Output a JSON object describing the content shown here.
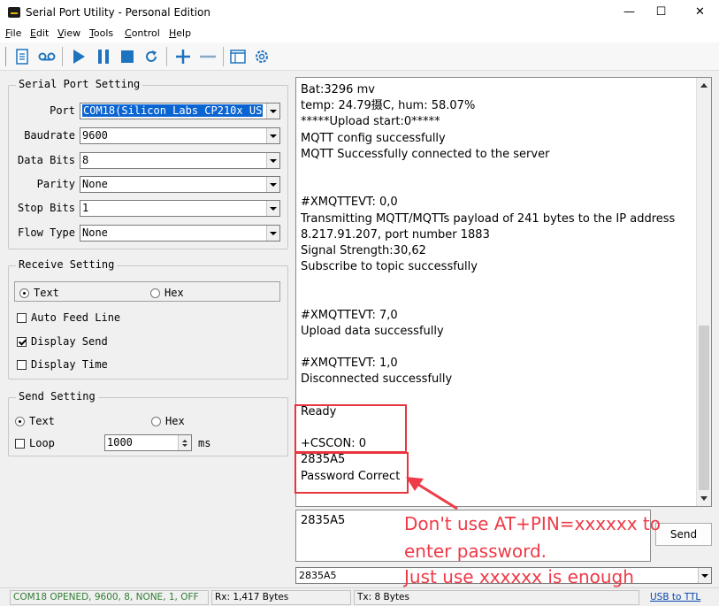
{
  "window": {
    "title": "Serial Port Utility - Personal Edition",
    "minimize": "—",
    "maximize": "☐",
    "close": "✕"
  },
  "menu": {
    "items": [
      {
        "key": "F",
        "rest": "ile"
      },
      {
        "key": "E",
        "rest": "dit"
      },
      {
        "key": "V",
        "rest": "iew"
      },
      {
        "key": "T",
        "rest": "ools"
      },
      {
        "key": "C",
        "rest": "ontrol"
      },
      {
        "key": "H",
        "rest": "elp"
      }
    ]
  },
  "toolbar": {
    "icons": [
      "document-icon",
      "tape-icon",
      "play-icon",
      "pause-icon",
      "stop-icon",
      "refresh-icon",
      "add-icon",
      "remove-icon",
      "window-icon",
      "settings-icon"
    ],
    "accent": "#1e73be"
  },
  "serial_port_setting": {
    "title": "Serial Port Setting",
    "fields": [
      {
        "label": "Port",
        "value": "COM18(Silicon Labs CP210x US"
      },
      {
        "label": "Baudrate",
        "value": "9600"
      },
      {
        "label": "Data Bits",
        "value": "8"
      },
      {
        "label": "Parity",
        "value": "None"
      },
      {
        "label": "Stop Bits",
        "value": "1"
      },
      {
        "label": "Flow Type",
        "value": "None"
      }
    ]
  },
  "receive_setting": {
    "title": "Receive Setting",
    "text_label": "Text",
    "hex_label": "Hex",
    "mode": "Text",
    "auto_feed_line": {
      "label": "Auto Feed Line",
      "checked": false
    },
    "display_send": {
      "label": "Display Send",
      "checked": true
    },
    "display_time": {
      "label": "Display Time",
      "checked": false
    }
  },
  "send_setting": {
    "title": "Send Setting",
    "text_label": "Text",
    "hex_label": "Hex",
    "mode": "Text",
    "loop": {
      "label": "Loop",
      "checked": false
    },
    "interval_value": "1000",
    "interval_unit": "ms"
  },
  "receive_log": {
    "lines": [
      "Bat:3296 mv",
      "temp: 24.79摄C, hum: 58.07%",
      "*****Upload start:0*****",
      "MQTT config successfully",
      "MQTT Successfully connected to the server",
      "",
      "",
      "#XMQTTEVT: 0,0",
      "Transmitting MQTT/MQTTs payload of 241 bytes to the IP address",
      "8.217.91.207, port number 1883",
      "Signal Strength:30,62",
      "Subscribe to topic successfully",
      "",
      "",
      "#XMQTTEVT: 7,0",
      "Upload data successfully",
      "",
      "#XMQTTEVT: 1,0",
      "Disconnected successfully",
      "",
      "Ready",
      "",
      "+CSCON: 0",
      "2835A5",
      "Password Correct"
    ]
  },
  "send_box": {
    "text": "2835A5",
    "send_label": "Send"
  },
  "history": {
    "value": "2835A5"
  },
  "annotation": {
    "lines": [
      "Don't use AT+PIN=xxxxxx to",
      "enter password.",
      "Just use xxxxxx is enough"
    ],
    "color": "#ee3b47"
  },
  "status": {
    "port_status": "COM18 OPENED, 9600, 8, NONE, 1, OFF",
    "rx": "Rx: 1,417 Bytes",
    "tx": "Tx: 8 Bytes",
    "link": "USB to TTL",
    "port_status_color": "#2e7d32"
  }
}
